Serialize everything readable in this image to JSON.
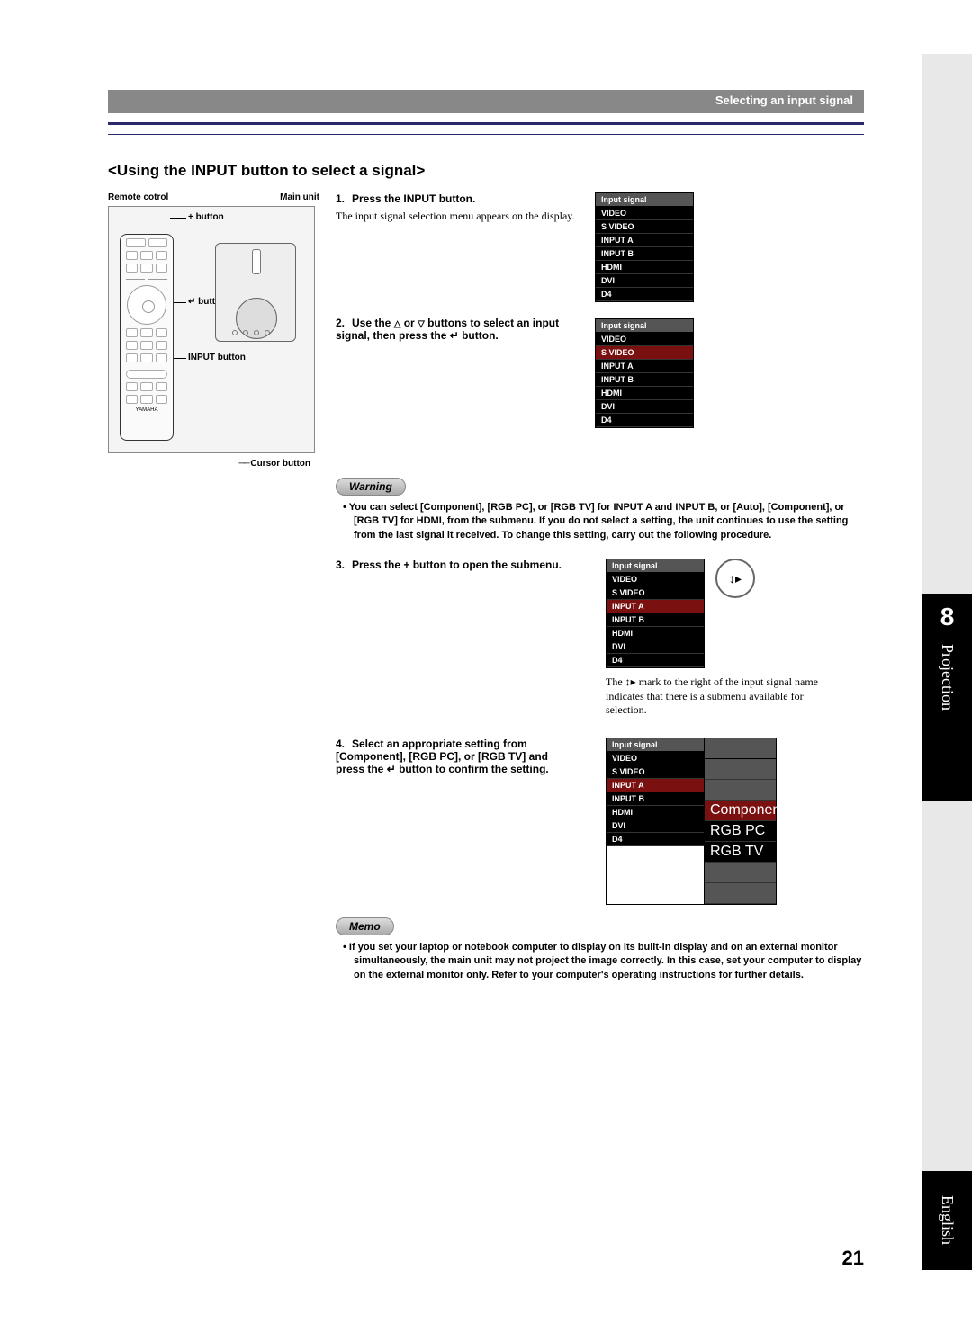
{
  "header": {
    "breadcrumb": "Selecting an input signal"
  },
  "section_title": "<Using the INPUT button to select a signal>",
  "fig": {
    "remote_label": "Remote cotrol",
    "main_label": "Main unit",
    "plus_btn": "+ button",
    "enter_btn": "button",
    "input_btn": "INPUT button",
    "cursor_btn": "Cursor button",
    "brand": "YAMAHA"
  },
  "steps": {
    "s1": {
      "num": "1.",
      "head": "Press the INPUT button.",
      "body": "The input signal selection menu appears on the display."
    },
    "s2": {
      "num": "2.",
      "head_a": "Use the ",
      "head_b": " or ",
      "head_c": " buttons to select an input signal, then press the ",
      "head_d": " button."
    },
    "s3": {
      "num": "3.",
      "head": "Press the + button to open the submenu."
    },
    "s4": {
      "num": "4.",
      "head_a": "Select an appropriate setting from  [Component], [RGB PC], or [RGB TV] and press the ",
      "head_b": " button to confirm the setting."
    }
  },
  "warning": {
    "label": "Warning",
    "text": "You can select [Component], [RGB PC], or [RGB TV] for INPUT A and INPUT B, or [Auto], [Component], or [RGB TV] for HDMI, from the submenu. If you do not select a setting, the unit continues to use the setting from the last signal it received. To change this setting, carry out the following procedure."
  },
  "memo": {
    "label": "Memo",
    "text": "If you set your laptop or notebook computer to display on its built-in display and on an external monitor simultaneously, the main unit may not project the image correctly. In this case, set your computer to display on the external monitor only. Refer to your computer's operating instructions for further details."
  },
  "osd": {
    "title": "Input signal",
    "rows": [
      "VIDEO",
      "S VIDEO",
      "INPUT A",
      "INPUT B",
      "HDMI",
      "DVI",
      "D4"
    ],
    "sub": {
      "row0": "Component",
      "row1": "RGB PC",
      "row2": "RGB TV"
    }
  },
  "right_note": "The   mark to the right of the input signal name indicates that there is a submenu available for selection.",
  "right_note_prefix": "The ",
  "right_note_suffix": " mark to the right of the input signal name indicates that there is a submenu available for selection.",
  "chapter": {
    "num": "8",
    "name": "Projection"
  },
  "language": "English",
  "page_number": "21",
  "glyphs": {
    "up": "△",
    "down": "▽",
    "enter": "↵",
    "submenu": "↕▸"
  }
}
